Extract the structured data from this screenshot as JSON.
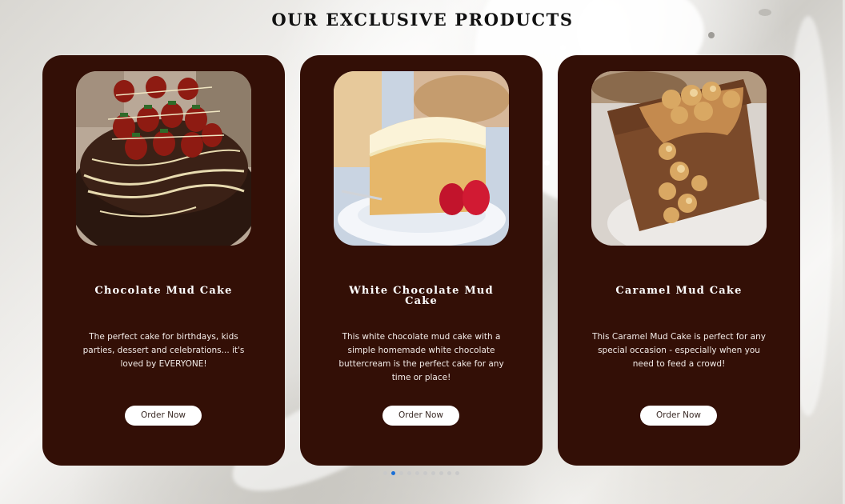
{
  "section": {
    "title": "OUR EXCLUSIVE PRODUCTS"
  },
  "products": [
    {
      "name": "Chocolate Mud Cake",
      "description": "The perfect cake for birthdays, kids parties, dessert and celebrations... it's loved by EVERYONE!",
      "button_label": "Order Now",
      "image": "chocolate-mud-cake-photo"
    },
    {
      "name": "White Chocolate Mud Cake",
      "description": "This white chocolate mud cake with a simple homemade white chocolate buttercream is the perfect cake for any time or place!",
      "button_label": "Order Now",
      "image": "white-chocolate-mud-cake-photo"
    },
    {
      "name": "Caramel Mud Cake",
      "description": "This Caramel Mud Cake is perfect for any special occasion - especially when you need to feed a crowd!",
      "button_label": "Order Now",
      "image": "caramel-mud-cake-photo"
    }
  ],
  "carousel": {
    "dot_count": 10,
    "active_index": 1
  },
  "colors": {
    "card_background": "#330f06",
    "button_background": "#ffffff",
    "active_dot": "#1a6fd6"
  }
}
